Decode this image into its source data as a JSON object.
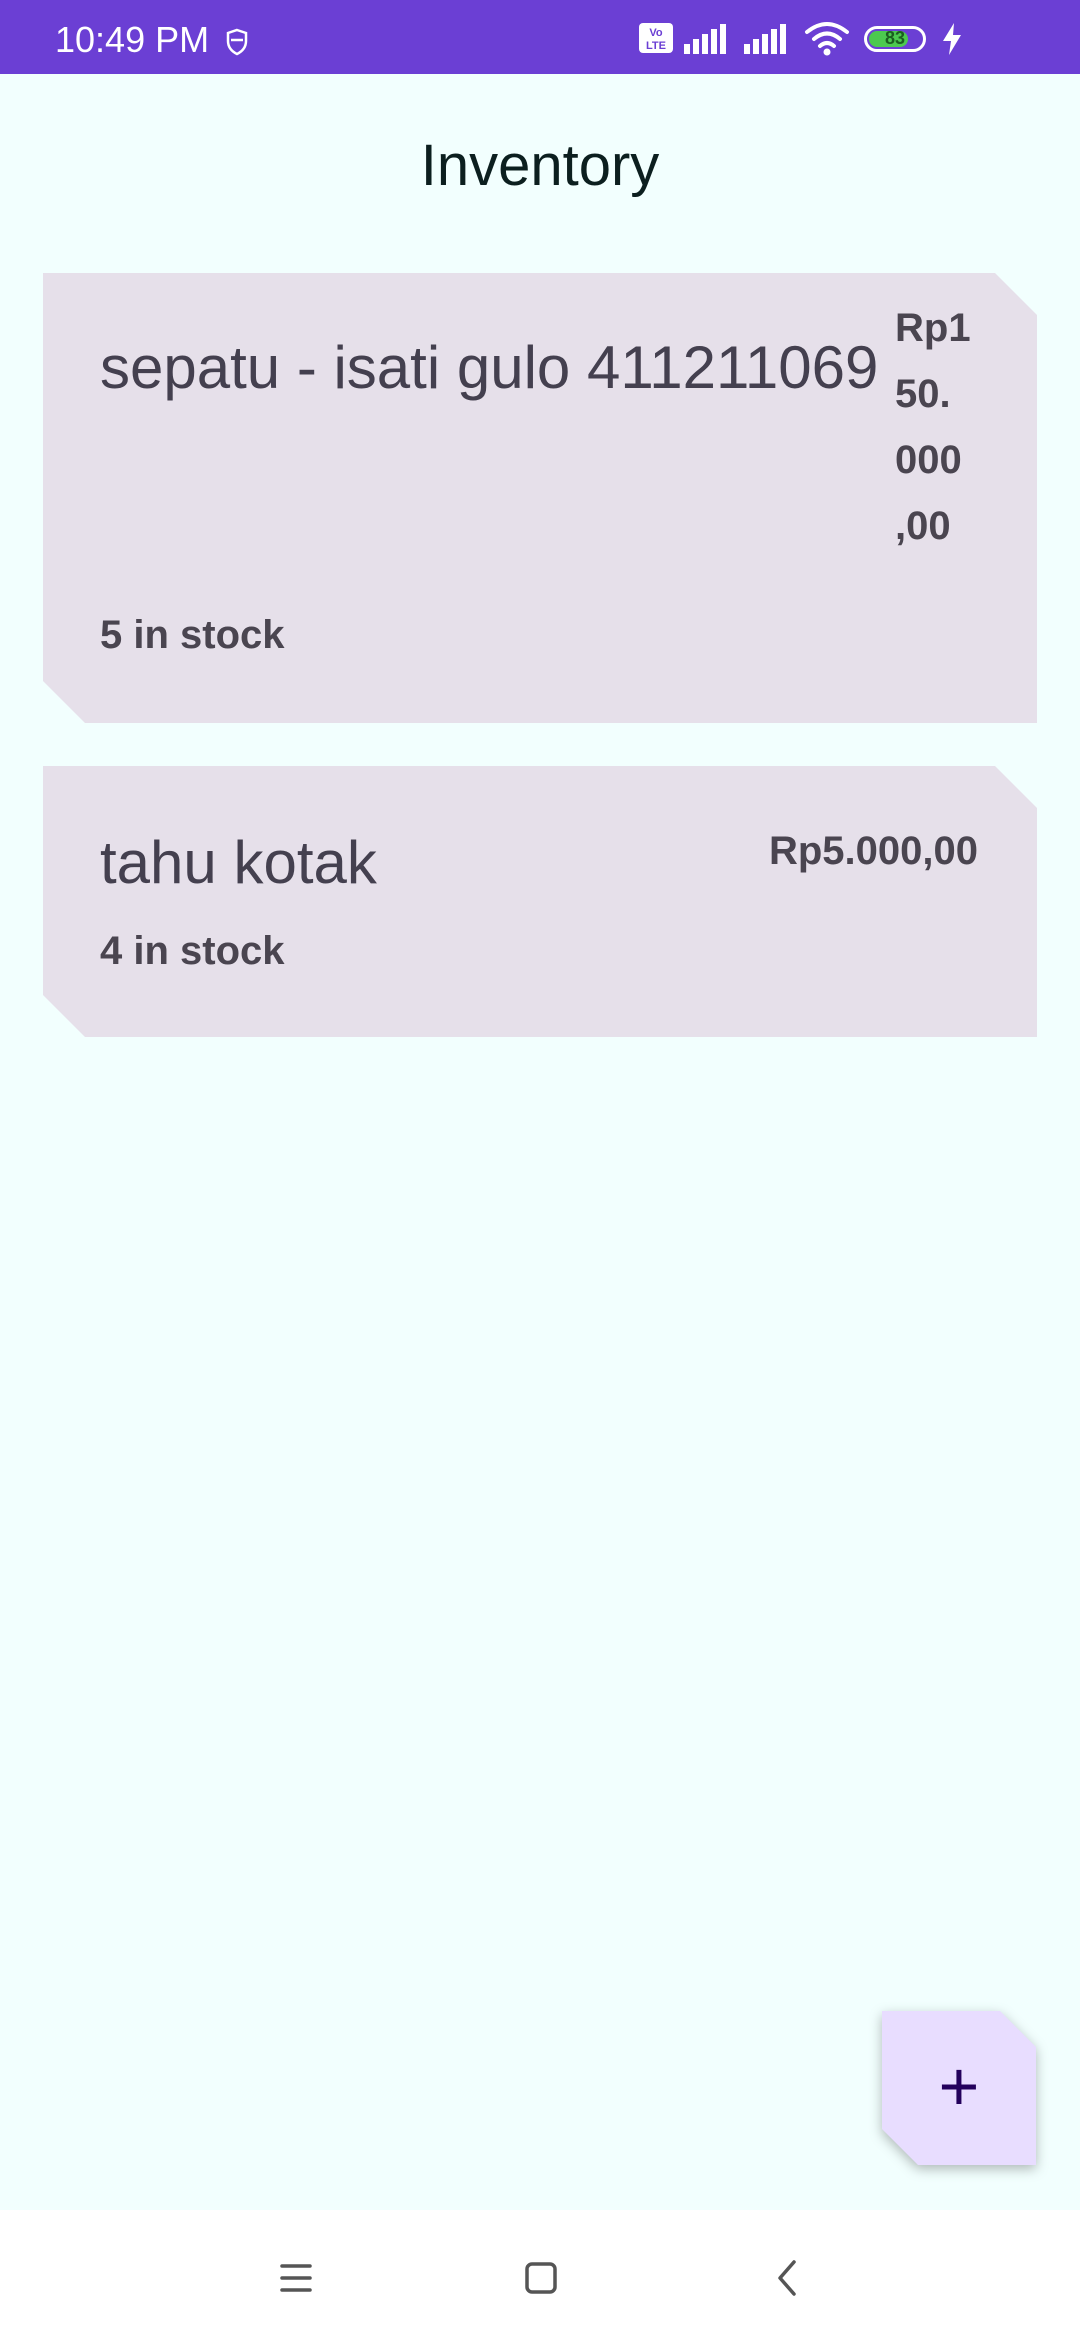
{
  "status_bar": {
    "time": "10:49 PM",
    "battery_level": "83",
    "icons": [
      "shield-icon",
      "volte-icon",
      "signal-icon",
      "signal-icon",
      "wifi-icon",
      "battery-icon",
      "charging-icon"
    ]
  },
  "page": {
    "title": "Inventory"
  },
  "items": [
    {
      "name": "sepatu - isati gulo 411211069",
      "price": "Rp150.000,00",
      "price_lines": [
        "Rp1",
        "50.",
        "000",
        ",00"
      ],
      "stock": "5 in stock"
    },
    {
      "name": "tahu kotak",
      "price": "Rp5.000,00",
      "stock": "4 in stock"
    }
  ],
  "fab": {
    "label": "+",
    "icon": "plus-icon"
  },
  "nav_bar": {
    "icons": [
      "menu-icon",
      "home-icon",
      "back-icon"
    ]
  },
  "colors": {
    "status_bar": "#6b3fd4",
    "background": "#f2fffe",
    "card": "#e6e0ea",
    "fab": "#e8ddff"
  }
}
